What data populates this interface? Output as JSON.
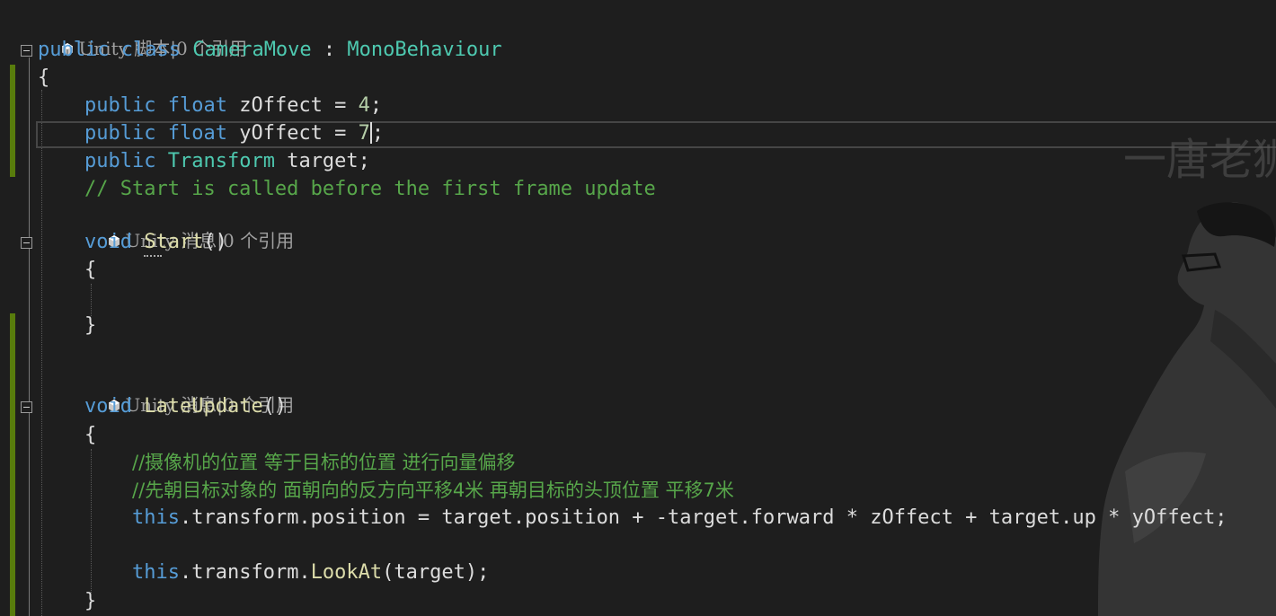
{
  "editor": {
    "lines": {
      "lens1": {
        "text": "Unity 脚本|0 个引用"
      },
      "class_decl": {
        "kw1": "public",
        "kw2": "class",
        "name": "CameraMove",
        "colon": " : ",
        "base": "MonoBehaviour"
      },
      "brace_open": "{",
      "field_z": {
        "kw1": "public",
        "kw2": "float",
        "rest": " zOffect = ",
        "num": "4",
        "end": ";"
      },
      "field_y": {
        "kw1": "public",
        "kw2": "float",
        "rest": " yOffect = ",
        "num": "7",
        "end": ";"
      },
      "field_t": {
        "kw1": "public",
        "type": "Transform",
        "rest": " target;"
      },
      "comment_start": "// Start is called before the first frame update",
      "lens2": {
        "text": "Unity 消息|0 个引用"
      },
      "start_decl": {
        "kw": "void",
        "name": "Start",
        "paren": "()"
      },
      "start_open": "{",
      "start_close": "}",
      "lens3": {
        "text": "Unity 消息|0 个引用"
      },
      "late_decl": {
        "kw": "void",
        "name": "LateUpdate",
        "paren": "()"
      },
      "late_open": "{",
      "comment_cn1": "//摄像机的位置 等于目标的位置 进行向量偏移",
      "comment_cn2": "//先朝目标对象的 面朝向的反方向平移4米 再朝目标的头顶位置 平移7米",
      "stmt1": {
        "this": "this",
        "rest": ".transform.position = target.position + -target.forward * zOffect + target.up * yOffect;"
      },
      "stmt2": {
        "this": "this",
        "mid": ".transform.",
        "fn": "LookAt",
        "rest": "(target);"
      },
      "late_close": "}"
    },
    "watermark": "一唐老狮",
    "colors": {
      "background": "#1e1e1e",
      "keyword": "#569cd6",
      "type": "#4ec9b0",
      "method": "#dcdcaa",
      "comment": "#57a64a",
      "number": "#b5cea8",
      "change_bar": "#587c0c"
    },
    "icons": [
      "unity-cube-icon",
      "collapse-icon"
    ]
  }
}
